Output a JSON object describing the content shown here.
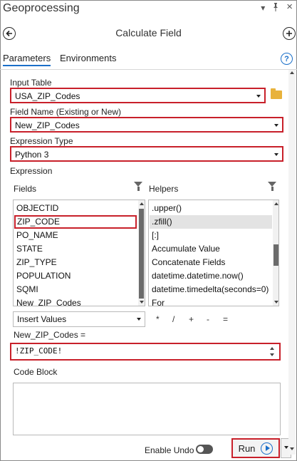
{
  "pane": {
    "title": "Geoprocessing",
    "pin_icon": "pin-icon",
    "close_label": "×",
    "menu_label": "▾"
  },
  "tool": {
    "title": "Calculate Field",
    "back_icon": "arrow-left-circle-icon",
    "add_icon": "plus-circle-icon"
  },
  "tabs": [
    {
      "label": "Parameters",
      "active": true
    },
    {
      "label": "Environments",
      "active": false
    }
  ],
  "help_label": "?",
  "params": {
    "input_table": {
      "label": "Input Table",
      "value": "USA_ZIP_Codes"
    },
    "field_name": {
      "label": "Field Name (Existing or New)",
      "value": "New_ZIP_Codes"
    },
    "expression_type": {
      "label": "Expression Type",
      "value": "Python 3"
    }
  },
  "expression": {
    "label": "Expression",
    "fields_label": "Fields",
    "helpers_label": "Helpers",
    "fields": [
      "OBJECTID",
      "ZIP_CODE",
      "PO_NAME",
      "STATE",
      "ZIP_TYPE",
      "POPULATION",
      "SQMI",
      "New_ZIP_Codes"
    ],
    "selected_field": "ZIP_CODE",
    "helpers": [
      ".upper()",
      ".zfill()",
      "[:]",
      "Accumulate Value",
      "Concatenate Fields",
      "datetime.datetime.now()",
      "datetime.timedelta(seconds=0)",
      "For"
    ],
    "selected_helper": ".zfill()",
    "insert_values": "Insert Values",
    "operators": [
      "*",
      "/",
      "+",
      "-",
      "="
    ],
    "target_label": "New_ZIP_Codes =",
    "value": "!ZIP_CODE!"
  },
  "code_block": {
    "label": "Code Block",
    "value": ""
  },
  "footer": {
    "enable_undo_label": "Enable Undo",
    "enable_undo_on": false,
    "run_label": "Run"
  },
  "colors": {
    "accent": "#1a6fc9",
    "highlight": "#c8202a"
  }
}
